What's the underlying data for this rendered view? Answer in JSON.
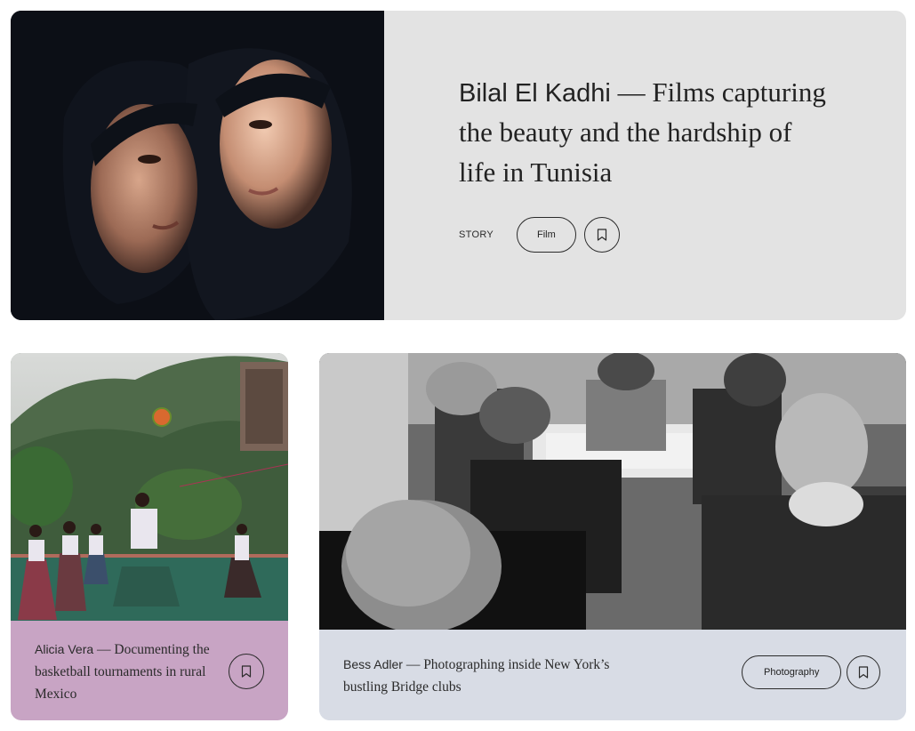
{
  "featured": {
    "author": "Bilal El Kadhi",
    "separator": " — ",
    "title": "Films capturing the beauty and the hardship of life in Tunisia",
    "label": "STORY",
    "tag": "Film",
    "bookmark_icon": "bookmark-icon"
  },
  "cards": [
    {
      "author": "Alicia Vera",
      "separator": " — ",
      "title": "Documenting the basketball tournaments in rural Mexico",
      "bookmark_icon": "bookmark-icon",
      "caption_color": "#c8a4c4"
    },
    {
      "author": "Bess Adler",
      "separator": " — ",
      "title": "Photographing inside New York’s bustling Bridge clubs",
      "tag": "Photography",
      "bookmark_icon": "bookmark-icon",
      "caption_color": "#d8dce5"
    }
  ],
  "colors": {
    "feature_background": "#e3e3e3",
    "text": "#222222",
    "border": "#2b2b2b"
  }
}
